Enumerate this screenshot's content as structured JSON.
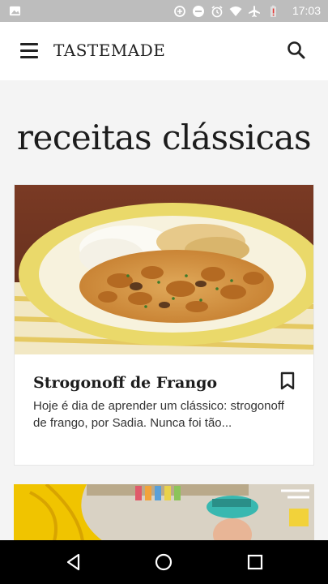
{
  "status_bar": {
    "time": "17:03",
    "icons": [
      "image-icon",
      "data-saver-icon",
      "dnd-icon",
      "alarm-icon",
      "wifi-icon",
      "airplane-icon",
      "battery-alert-icon"
    ]
  },
  "header": {
    "brand": "TASTEMADE",
    "menu_icon": "hamburger-menu-icon",
    "search_icon": "search-icon"
  },
  "page": {
    "title": "receitas clássicas"
  },
  "cards": [
    {
      "title": "Strogonoff de Frango",
      "description": "Hoje é dia de aprender um clássico: strogonoff de frango, por Sadia. Nunca foi tão...",
      "bookmark_icon": "bookmark-icon"
    }
  ],
  "nav_bar": {
    "back_icon": "back-icon",
    "home_icon": "home-icon",
    "recents_icon": "recents-icon"
  }
}
